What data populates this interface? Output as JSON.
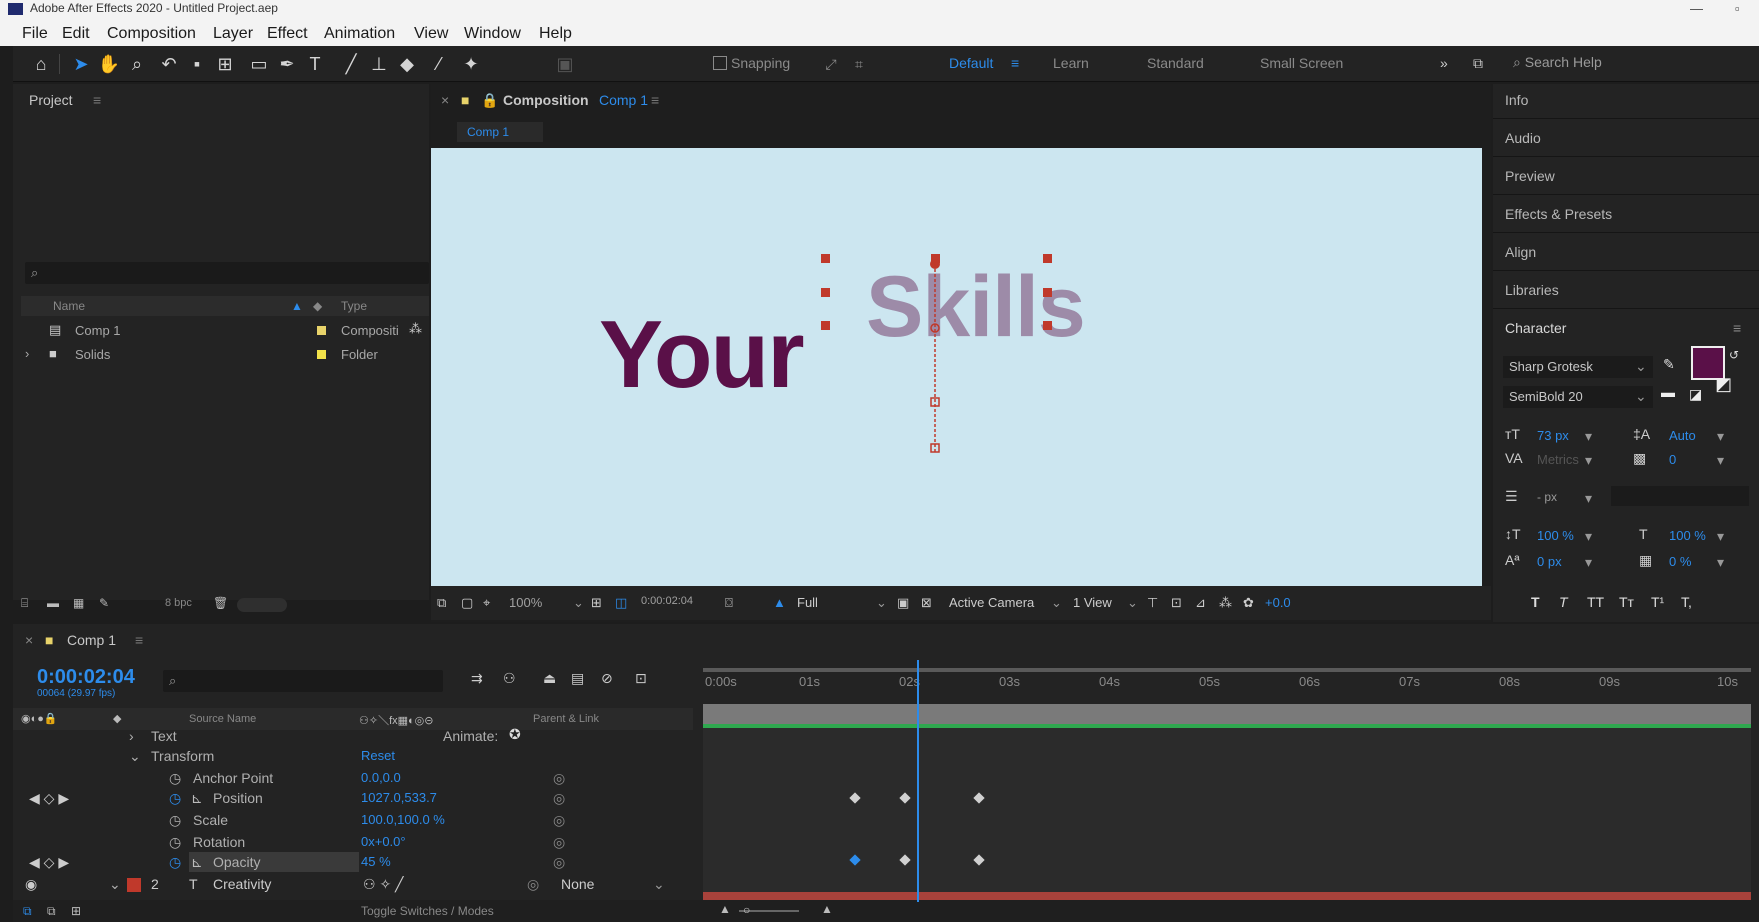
{
  "window": {
    "title": "Adobe After Effects 2020 - Untitled Project.aep"
  },
  "menu": [
    "File",
    "Edit",
    "Composition",
    "Layer",
    "Effect",
    "Animation",
    "View",
    "Window",
    "Help"
  ],
  "toolbar": {
    "snapping_label": "Snapping",
    "workspaces": [
      "Default",
      "Learn",
      "Standard",
      "Small Screen"
    ],
    "active_workspace": "Default",
    "search_placeholder": "Search Help"
  },
  "project": {
    "title": "Project",
    "columns": {
      "name": "Name",
      "type": "Type"
    },
    "items": [
      {
        "name": "Comp 1",
        "type": "Compositi",
        "label_color": "#e8d36a"
      },
      {
        "name": "Solids",
        "type": "Folder",
        "label_color": "#f2e24a"
      }
    ],
    "bpc": "8 bpc"
  },
  "composition": {
    "panel_title": "Composition",
    "comp_name": "Comp 1",
    "tab": "Comp 1",
    "canvas_color": "#cce6f0",
    "text_layers": [
      {
        "text": "Your",
        "color": "#5a1048"
      },
      {
        "text": "Skills",
        "color": "#9d8ba8"
      }
    ],
    "viewer": {
      "zoom": "100%",
      "timecode": "0:00:02:04",
      "resolution": "Full",
      "camera": "Active Camera",
      "views": "1 View",
      "exposure": "+0.0"
    }
  },
  "right_panel": {
    "panels": [
      "Info",
      "Audio",
      "Preview",
      "Effects & Presets",
      "Align",
      "Libraries",
      "Character"
    ],
    "character": {
      "font": "Sharp Grotesk",
      "style": "SemiBold 20",
      "size": "73 px",
      "leading": "Auto",
      "kerning": "Metrics",
      "tracking": "0",
      "stroke": "- px",
      "vertical_scale": "100 %",
      "horizontal_scale": "100 %",
      "baseline": "0 px",
      "tsume": "0 %",
      "fill_color": "#5a1048",
      "style_buttons": [
        "T",
        "T",
        "TT",
        "Tт",
        "T¹",
        "T,"
      ]
    }
  },
  "timeline": {
    "comp_tab": "Comp 1",
    "timecode": "0:00:02:04",
    "timecode_sub": "00064 (29.97 fps)",
    "columns": {
      "source_name": "Source Name",
      "parent": "Parent & Link"
    },
    "ticks": [
      "0:00s",
      "01s",
      "02s",
      "03s",
      "04s",
      "05s",
      "06s",
      "07s",
      "08s",
      "09s",
      "10s"
    ],
    "properties": [
      {
        "name": "Text",
        "value": "",
        "extra": "Animate:"
      },
      {
        "name": "Transform",
        "value": "Reset",
        "extra": ""
      },
      {
        "name": "Anchor Point",
        "value": "0.0,0.0",
        "extra": ""
      },
      {
        "name": "Position",
        "value": "1027.0,533.7",
        "extra": ""
      },
      {
        "name": "Scale",
        "value": "100.0,100.0 %",
        "extra": ""
      },
      {
        "name": "Rotation",
        "value": "0x+0.0°",
        "extra": ""
      },
      {
        "name": "Opacity",
        "value": "45 %",
        "extra": ""
      }
    ],
    "layer2": {
      "index": "2",
      "name": "Creativity",
      "parent": "None",
      "label_color": "#c0392b"
    },
    "footer": "Toggle Switches / Modes"
  }
}
